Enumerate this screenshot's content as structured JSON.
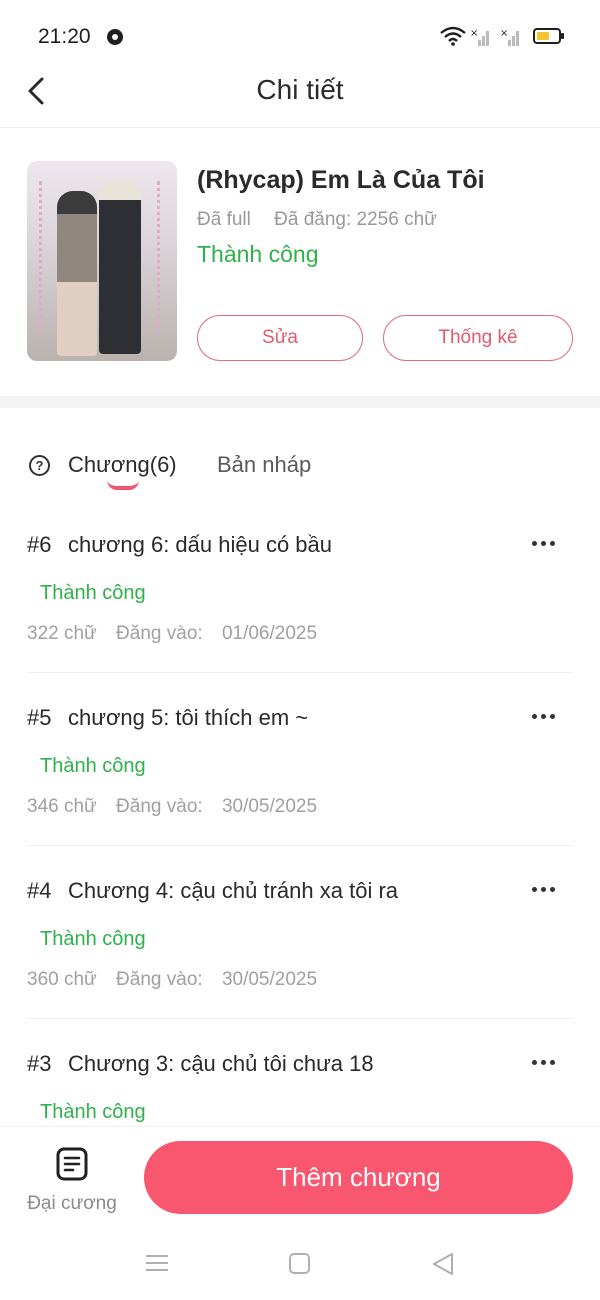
{
  "status_bar": {
    "time": "21:20"
  },
  "header": {
    "title": "Chi tiết"
  },
  "story": {
    "title": "(Rhycap) Em Là Của Tôi",
    "progress": "Đã full",
    "posted": "Đã đăng: 2256 chữ",
    "status": "Thành công",
    "edit_label": "Sửa",
    "stats_label": "Thống kê"
  },
  "tabs": {
    "chapters": "Chương(6)",
    "drafts": "Bản nháp"
  },
  "chapters": [
    {
      "num": "#6",
      "title": "chương 6: dấu hiệu có bầu",
      "status": "Thành công",
      "words": "322 chữ",
      "posted_label": "Đăng vào:",
      "date": "01/06/2025"
    },
    {
      "num": "#5",
      "title": "chương 5: tôi thích em ~",
      "status": "Thành công",
      "words": "346 chữ",
      "posted_label": "Đăng vào:",
      "date": "30/05/2025"
    },
    {
      "num": "#4",
      "title": "Chương 4: cậu chủ tránh xa tôi ra",
      "status": "Thành công",
      "words": "360 chữ",
      "posted_label": "Đăng vào:",
      "date": "30/05/2025"
    },
    {
      "num": "#3",
      "title": "Chương 3: cậu chủ tôi chưa 18",
      "status": "Thành công"
    }
  ],
  "bottom": {
    "outline_label": "Đại cương",
    "add_chapter_label": "Thêm chương"
  },
  "colors": {
    "accent": "#f9566f",
    "success": "#2fb24a"
  },
  "icons": {
    "back": "chevron-left-icon",
    "help": "question-circle-icon",
    "more": "more-horizontal-icon",
    "outline": "document-list-icon"
  }
}
